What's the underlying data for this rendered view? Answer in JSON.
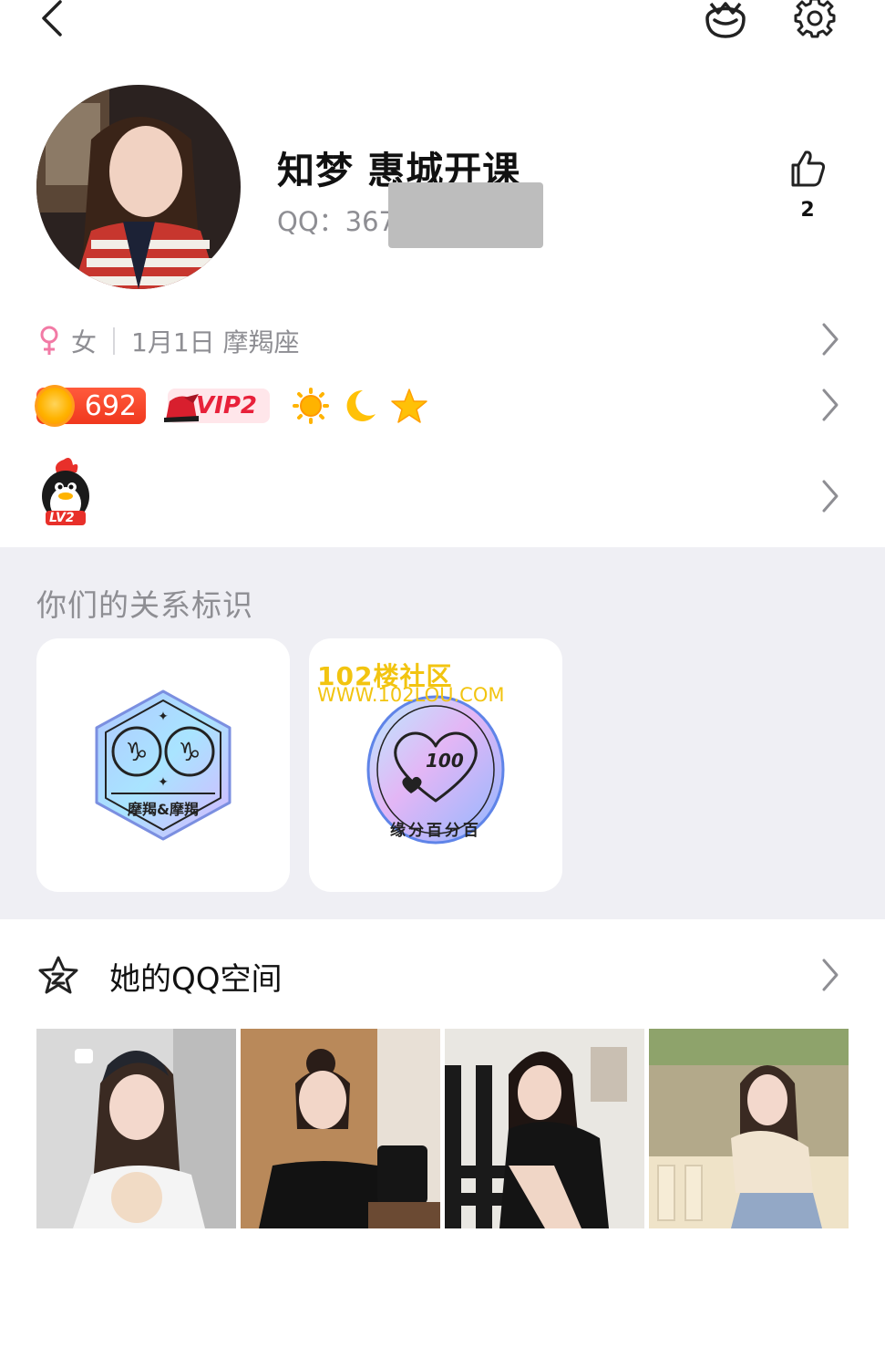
{
  "topbar": {
    "back_icon": "chevron-left-icon",
    "face_icon": "dress-up-face-icon",
    "settings_icon": "gear-icon"
  },
  "profile": {
    "nickname": "知梦 惠城开课",
    "qq_label": "QQ：367",
    "like_count": "2"
  },
  "info": {
    "gender": "女",
    "birthday_sign": "1月1日 摩羯座"
  },
  "badges": {
    "coin_value": "692",
    "vip_label": "VIP2",
    "level_icons": [
      "sun-icon",
      "moon-icon",
      "star-icon"
    ]
  },
  "qq_level": {
    "label": "LV2"
  },
  "relation": {
    "title": "你们的关系标识",
    "cards": [
      {
        "caption": "摩羯&摩羯"
      },
      {
        "value": "100",
        "caption": "缘分百分百"
      }
    ],
    "watermark_line1": "102楼社区",
    "watermark_line2": "WWW.102LOU.COM"
  },
  "qzone": {
    "label": "她的QQ空间"
  },
  "colors": {
    "accent_red": "#f0381e",
    "vip_red": "#e8213a",
    "secondary_text": "#8e8e93",
    "section_bg": "#efeff4",
    "watermark_yellow": "#f2c410"
  }
}
